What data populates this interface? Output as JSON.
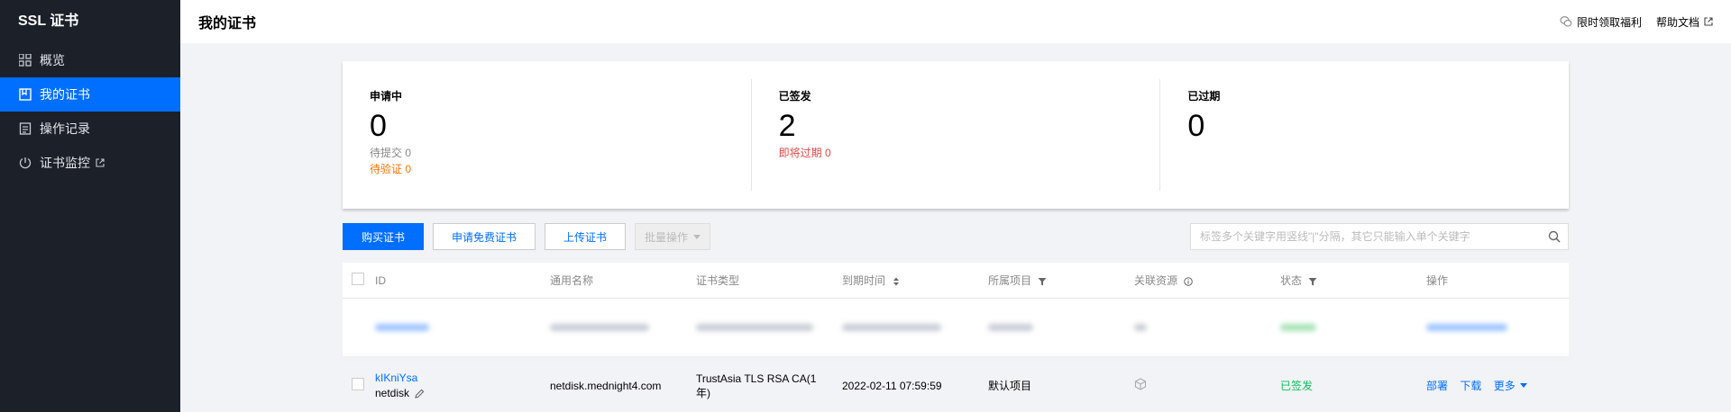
{
  "sidebar": {
    "title": "SSL 证书",
    "items": [
      {
        "label": "概览",
        "icon": "grid-icon"
      },
      {
        "label": "我的证书",
        "icon": "certificate-icon",
        "active": true
      },
      {
        "label": "操作记录",
        "icon": "log-icon"
      },
      {
        "label": "证书监控",
        "icon": "monitor-icon",
        "external": true
      }
    ]
  },
  "header": {
    "title": "我的证书",
    "links": [
      {
        "label": "限时领取福利",
        "icon": "wechat-icon"
      },
      {
        "label": "帮助文档",
        "icon": "external-link-icon"
      }
    ]
  },
  "stats": [
    {
      "label": "申请中",
      "value": "0",
      "subs": [
        {
          "text": "待提交 0",
          "color": "grey"
        },
        {
          "text": "待验证 0",
          "color": "orange"
        }
      ]
    },
    {
      "label": "已签发",
      "value": "2",
      "subs": [
        {
          "text": "即将过期 0",
          "color": "red"
        }
      ]
    },
    {
      "label": "已过期",
      "value": "0",
      "subs": []
    }
  ],
  "toolbar": {
    "buy": "购买证书",
    "apply_free": "申请免费证书",
    "upload": "上传证书",
    "batch": "批量操作",
    "search_placeholder": "标签多个关键字用竖线\"|\"分隔，其它只能输入单个关键字"
  },
  "table": {
    "columns": [
      "ID",
      "通用名称",
      "证书类型",
      "到期时间",
      "所属项目",
      "关联资源",
      "状态",
      "操作"
    ],
    "row": {
      "id": "kIKniYsa",
      "alias": "netdisk",
      "domain": "netdisk.mednight4.com",
      "type": "TrustAsia TLS RSA CA(1年)",
      "expire": "2022-02-11 07:59:59",
      "project": "默认项目",
      "status": "已签发",
      "ops": [
        "部署",
        "下载",
        "更多"
      ]
    }
  },
  "colors": {
    "accent": "#006eff",
    "sidebar_bg": "#1b2029",
    "success": "#0abf5b",
    "warning": "#ff7200",
    "danger": "#e54545"
  }
}
